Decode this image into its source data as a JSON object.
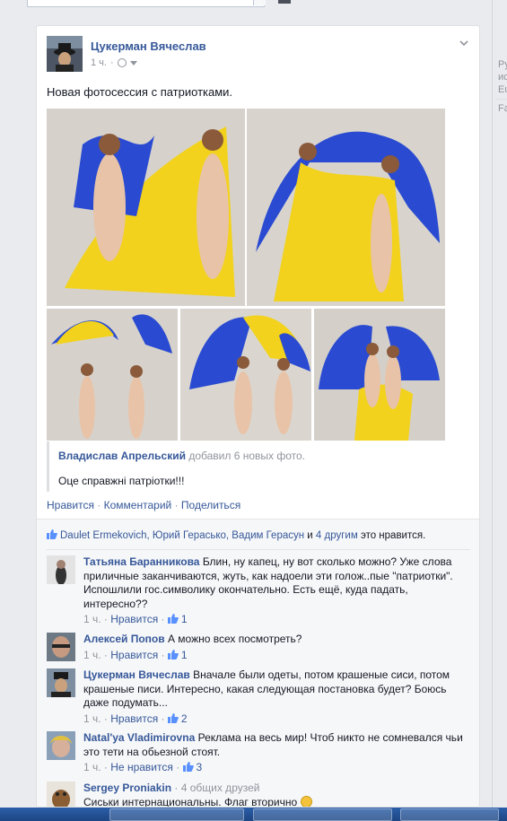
{
  "post": {
    "author": "Цукерман Вячеслав",
    "time": "1 ч.",
    "text": "Новая фотосессия с патриотками.",
    "shared": {
      "author": "Владислав Апрельский",
      "action": " добавил 6 новых фото.",
      "caption": "Оце справжні патріотки!!!"
    },
    "actions": {
      "like": "Нравится",
      "comment": "Комментарий",
      "share": "Поделиться",
      "sep": "·"
    },
    "likes": {
      "names": "Daulet Ermekovich, Юрий Герасько, Вадим Герасун",
      "and": " и ",
      "others": "4 другим",
      "suffix": " это нравится."
    }
  },
  "comments": [
    {
      "name": "Татьяна Баранникова",
      "text": "Блин, ну капец, ну вот сколько можно? Уже слова приличные заканчиваются, жуть, как надоели эти голож..пые \"патриотки\". Испошлили гос.символику окончательно. Есть ещё, куда падать, интересно??",
      "time": "1 ч.",
      "like": "Нравится",
      "count": "1"
    },
    {
      "name": "Алексей Попов",
      "text": "А можно всех посмотреть?",
      "time": "1 ч.",
      "like": "Нравится",
      "count": "1"
    },
    {
      "name": "Цукерман Вячеслав",
      "text": "Вначале были одеты, потом крашеные сиси, потом крашеные писи. Интересно, какая следующая постановка будет? Боюсь даже подумать...",
      "time": "1 ч.",
      "like": "Нравится",
      "count": "2"
    },
    {
      "name": "Natal'ya Vladimirovna",
      "text": "Реклама на весь мир! Чтоб никто не сомневался чьи это тети на обьезной стоят.",
      "time": "1 ч.",
      "like": "Не нравится",
      "count": "3"
    },
    {
      "name": "Sergey Proniakin",
      "extra": "· 4 общих друзей",
      "text": "Сиськи интернациональны. Флаг вторично"
    }
  ],
  "right_column": {
    "line1": "Ру",
    "line2": "ис",
    "line3": "Eu",
    "line4": "Fa"
  },
  "colors": {
    "link": "#365899",
    "flag_blue": "#2a4bd1",
    "flag_yellow": "#f2d21c",
    "background": "#e9ebee"
  },
  "icons": {
    "globe": "globe-icon",
    "caret": "privacy-caret-icon",
    "thumb": "like-thumb-icon",
    "chevron": "chevron-down-icon"
  }
}
